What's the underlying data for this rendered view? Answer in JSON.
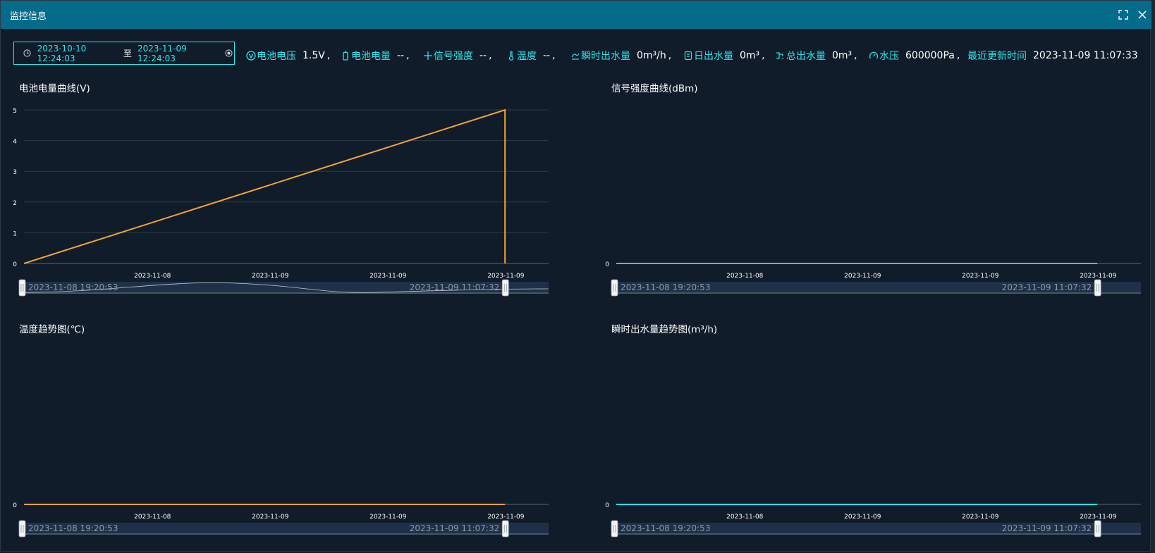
{
  "window": {
    "title": "监控信息"
  },
  "toolbar": {
    "date_start": "2023-10-10 12:24:03",
    "date_sep": "至",
    "date_end": "2023-11-09 12:24:03",
    "battery_voltage_label": "电池电压",
    "battery_voltage_value": "1.5V",
    "battery_level_label": "电池电量",
    "battery_level_value": "--",
    "signal_label": "信号强度",
    "signal_value": "--",
    "temperature_label": "温度",
    "temperature_value": "--",
    "instant_flow_label": "瞬时出水量",
    "instant_flow_value": "0m³/h",
    "daily_flow_label": "日出水量",
    "daily_flow_value": "0m³",
    "total_flow_label": "总出水量",
    "total_flow_value": "0m³",
    "pressure_label": "水压",
    "pressure_value": "600000Pa",
    "last_update_label": "最近更新时间",
    "last_update_value": "2023-11-09 11:07:33",
    "comma": ","
  },
  "colors": {
    "accent": "#2ee6f0",
    "titlebar": "#056b8b",
    "line_orange": "#f0a33a",
    "line_green": "#4ed17a",
    "line_cyan": "#1ee4f2"
  },
  "chart_data": [
    {
      "type": "line",
      "title": "电池电量曲线(V)",
      "x": [
        "2023-11-08 19:20:53",
        "2023-11-09 11:07:32",
        "2023-11-09 11:07:32"
      ],
      "y": [
        0,
        5,
        0
      ],
      "x_ticks": [
        "2023-11-08",
        "2023-11-09",
        "2023-11-09",
        "2023-11-09"
      ],
      "y_ticks": [
        0,
        1,
        2,
        3,
        4,
        5
      ],
      "ylim": [
        0,
        5
      ],
      "grid": true,
      "color": "#f0a33a",
      "zoom": {
        "start": "2023-11-08 19:20:53",
        "end": "2023-11-09 11:07:32"
      }
    },
    {
      "type": "line",
      "title": "信号强度曲线(dBm)",
      "x": [
        "2023-11-08 19:20:53",
        "2023-11-09 11:07:32"
      ],
      "y": [
        0,
        0
      ],
      "x_ticks": [
        "2023-11-08",
        "2023-11-09",
        "2023-11-09",
        "2023-11-09"
      ],
      "y_ticks": [
        0
      ],
      "grid": false,
      "color": "#4ed17a",
      "zoom": {
        "start": "2023-11-08 19:20:53",
        "end": "2023-11-09 11:07:32"
      }
    },
    {
      "type": "line",
      "title": "温度趋势图(℃)",
      "x": [
        "2023-11-08 19:20:53",
        "2023-11-09 11:07:32"
      ],
      "y": [
        0,
        0
      ],
      "x_ticks": [
        "2023-11-08",
        "2023-11-09",
        "2023-11-09",
        "2023-11-09"
      ],
      "y_ticks": [
        0
      ],
      "grid": false,
      "color": "#f0a33a",
      "zoom": {
        "start": "2023-11-08 19:20:53",
        "end": "2023-11-09 11:07:32"
      }
    },
    {
      "type": "line",
      "title": "瞬时出水量趋势图(m³/h)",
      "x": [
        "2023-11-08 19:20:53",
        "2023-11-09 11:07:32"
      ],
      "y": [
        0,
        0
      ],
      "x_ticks": [
        "2023-11-08",
        "2023-11-09",
        "2023-11-09",
        "2023-11-09"
      ],
      "y_ticks": [
        0
      ],
      "grid": false,
      "color": "#1ee4f2",
      "zoom": {
        "start": "2023-11-08 19:20:53",
        "end": "2023-11-09 11:07:32"
      }
    }
  ]
}
